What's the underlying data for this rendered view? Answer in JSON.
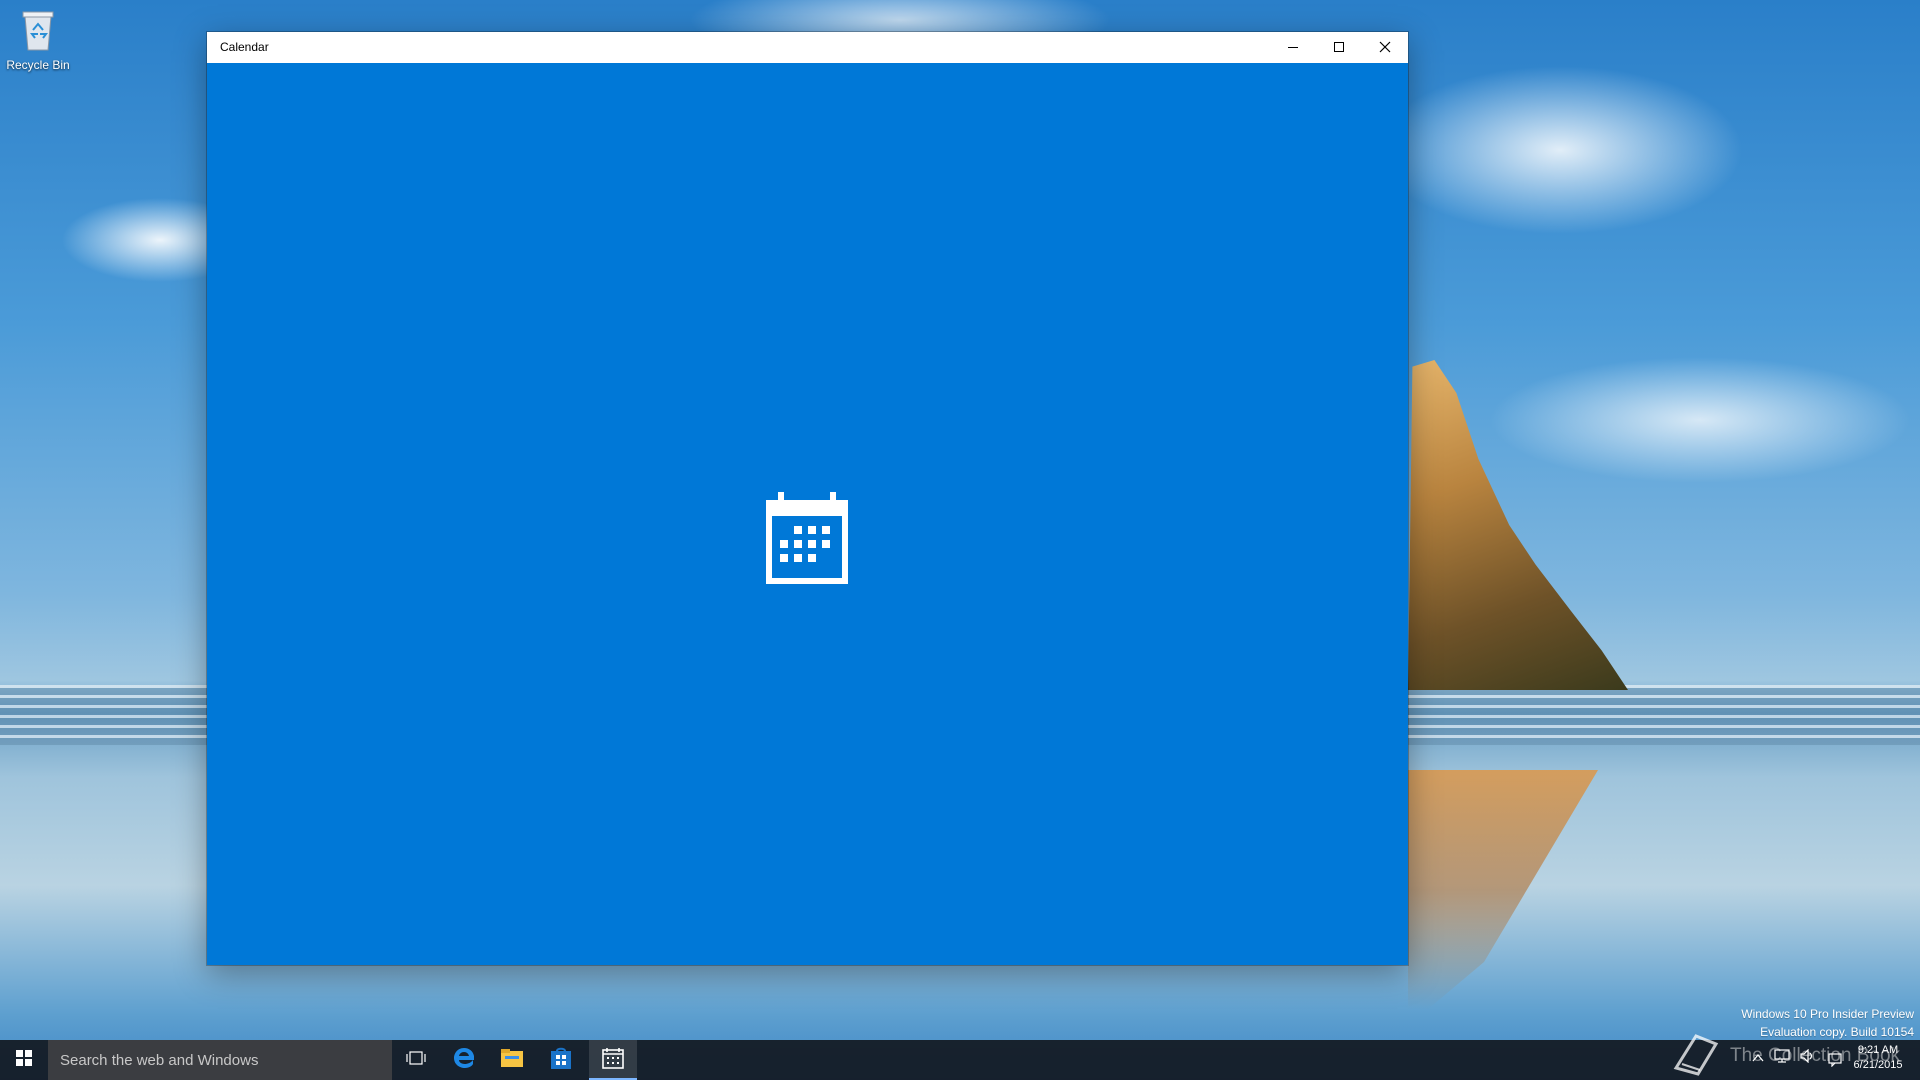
{
  "desktop": {
    "icons": [
      {
        "label": "Recycle Bin",
        "icon": "recycle-bin-icon"
      }
    ],
    "watermark": {
      "line1": "Windows 10 Pro Insider Preview",
      "line2": "Evaluation copy. Build 10154"
    }
  },
  "window": {
    "title": "Calendar",
    "controls": {
      "minimize": "minimize-icon",
      "maximize": "maximize-icon",
      "close": "close-icon"
    },
    "background_color": "#0078d7",
    "splash_icon": "calendar-icon"
  },
  "taskbar": {
    "search_placeholder": "Search the web and Windows",
    "pinned": [
      {
        "name": "task-view",
        "icon": "task-view-icon"
      },
      {
        "name": "edge",
        "icon": "edge-icon"
      },
      {
        "name": "file-explorer",
        "icon": "folder-icon"
      },
      {
        "name": "store",
        "icon": "store-icon"
      },
      {
        "name": "calendar",
        "icon": "calendar-icon",
        "active": true
      }
    ],
    "overlay_brand": "The Collection Book",
    "clock": {
      "time": "9:21 AM",
      "date": "6/21/2015"
    },
    "accent_color": "#7cb6ff"
  }
}
